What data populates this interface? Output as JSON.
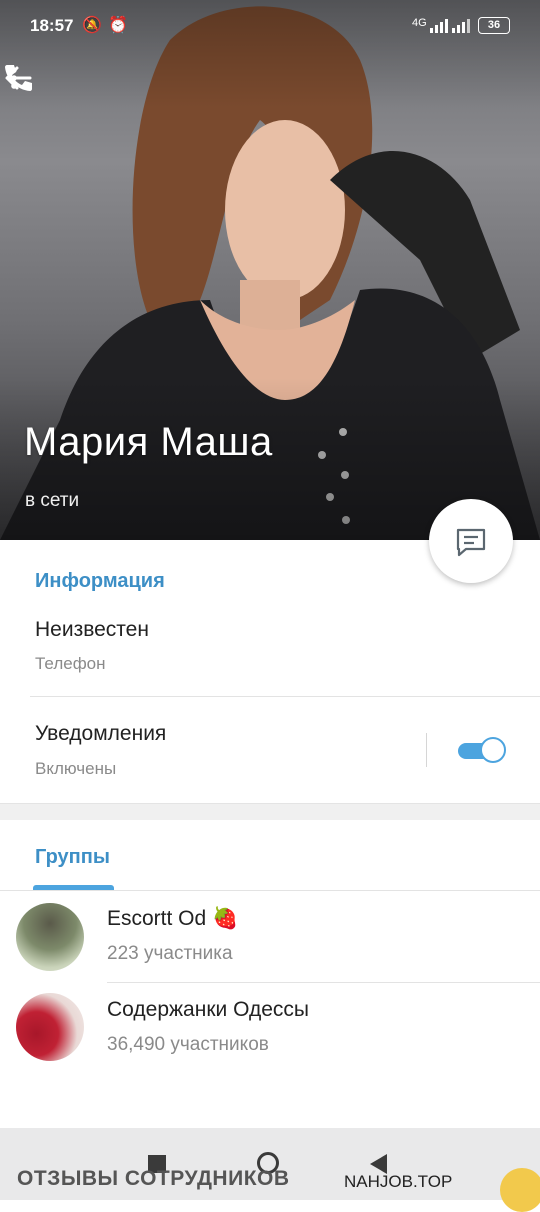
{
  "status_bar": {
    "time": "18:57",
    "network": "4G",
    "battery": "36",
    "icons": [
      "bell-off-icon",
      "alarm-icon",
      "signal-icon",
      "battery-icon"
    ]
  },
  "appbar": {
    "back_icon": "arrow-left-icon",
    "call_icon": "phone-icon",
    "more_icon": "more-vertical-icon"
  },
  "profile": {
    "name": "Мария Маша",
    "status": "в сети"
  },
  "info": {
    "section_title": "Информация",
    "phone_value": "Неизвестен",
    "phone_label": "Телефон",
    "notifications_title": "Уведомления",
    "notifications_state": "Включены",
    "notifications_enabled": true
  },
  "groups": {
    "tab_label": "Группы",
    "items": [
      {
        "name": "Escortt Od 🍓",
        "members": "223 участника"
      },
      {
        "name": "Содержанки Одессы",
        "members": "36,490 участников"
      }
    ]
  },
  "watermark": {
    "left": "ОТЗЫВЫ СОТРУДНИКОВ",
    "right": "NAHJOB.TOP"
  },
  "colors": {
    "accent": "#3d8fc6",
    "toggle": "#4ca4df"
  }
}
